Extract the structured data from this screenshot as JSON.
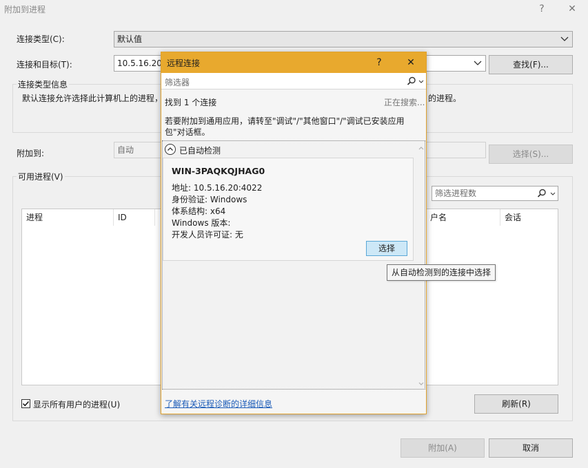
{
  "window": {
    "title": "附加到进程",
    "help_glyph": "?",
    "close_glyph": "✕"
  },
  "connection_type": {
    "label": "连接类型(C):",
    "value": "默认值"
  },
  "connection_target": {
    "label": "连接和目标(T):",
    "value": "10.5.16.20:4",
    "find_button": "查找(F)..."
  },
  "connection_info": {
    "title": "连接类型信息",
    "text_left": "默认连接允许选择此计算机上的进程，",
    "text_right": "的进程。"
  },
  "attach_to": {
    "label": "附加到:",
    "value": "自动",
    "select_button": "选择(S)..."
  },
  "available_processes": {
    "title": "可用进程(V)",
    "filter_placeholder": "筛选进程数",
    "columns": [
      "进程",
      "ID",
      "户名",
      "会话"
    ]
  },
  "show_all_users": {
    "label": "显示所有用户的进程(U)",
    "checked": true
  },
  "refresh_button": "刷新(R)",
  "attach_button": "附加(A)",
  "cancel_button": "取消",
  "popup": {
    "title": "远程连接",
    "help_glyph": "?",
    "close_glyph": "✕",
    "filter_placeholder": "筛选器",
    "found_text": "找到 1 个连接",
    "searching_text": "正在搜索...",
    "info_line1": "若要附加到通用应用，请转至\"调试\"/\"其他窗口\"/\"调试已安装应用",
    "info_line2": "包\"对话框。",
    "section_title": "已自动检测",
    "device": {
      "name": "WIN-3PAQKQJHAG0",
      "address": "地址: 10.5.16.20:4022",
      "auth": "身份验证: Windows",
      "arch": "体系结构: x64",
      "windows_version": "Windows 版本:",
      "dev_license": "开发人员许可证: 无"
    },
    "select_button": "选择",
    "tooltip": "从自动检测到的连接中选择",
    "help_link": "了解有关远程诊断的详细信息"
  },
  "colors": {
    "popup_header": "#e8a92e",
    "link": "#1a5bb8",
    "select_button_bg": "#cde8f7"
  }
}
